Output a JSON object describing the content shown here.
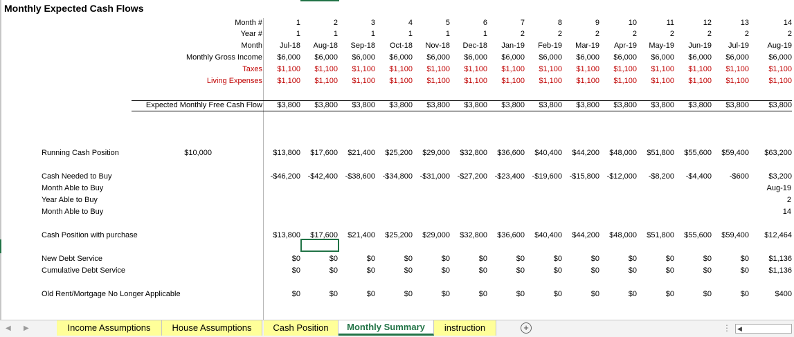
{
  "sheet_title": "Monthly Expected Cash Flows",
  "header_labels": {
    "month_num": "Month #",
    "year_num": "Year #",
    "month": "Month",
    "gross_income": "Monthly Gross Income",
    "taxes": "Taxes",
    "living": "Living Expenses",
    "free_cash": "Expected Monthly Free Cash Flow"
  },
  "month_nums": [
    "1",
    "2",
    "3",
    "4",
    "5",
    "6",
    "7",
    "8",
    "9",
    "10",
    "11",
    "12",
    "13",
    "14"
  ],
  "year_nums": [
    "1",
    "1",
    "1",
    "1",
    "1",
    "1",
    "2",
    "2",
    "2",
    "2",
    "2",
    "2",
    "2",
    "2"
  ],
  "months": [
    "Jul-18",
    "Aug-18",
    "Sep-18",
    "Oct-18",
    "Nov-18",
    "Dec-18",
    "Jan-19",
    "Feb-19",
    "Mar-19",
    "Apr-19",
    "May-19",
    "Jun-19",
    "Jul-19",
    "Aug-19"
  ],
  "gross_income": [
    "$6,000",
    "$6,000",
    "$6,000",
    "$6,000",
    "$6,000",
    "$6,000",
    "$6,000",
    "$6,000",
    "$6,000",
    "$6,000",
    "$6,000",
    "$6,000",
    "$6,000",
    "$6,000"
  ],
  "taxes": [
    "$1,100",
    "$1,100",
    "$1,100",
    "$1,100",
    "$1,100",
    "$1,100",
    "$1,100",
    "$1,100",
    "$1,100",
    "$1,100",
    "$1,100",
    "$1,100",
    "$1,100",
    "$1,100"
  ],
  "living": [
    "$1,100",
    "$1,100",
    "$1,100",
    "$1,100",
    "$1,100",
    "$1,100",
    "$1,100",
    "$1,100",
    "$1,100",
    "$1,100",
    "$1,100",
    "$1,100",
    "$1,100",
    "$1,100"
  ],
  "free_cash": [
    "$3,800",
    "$3,800",
    "$3,800",
    "$3,800",
    "$3,800",
    "$3,800",
    "$3,800",
    "$3,800",
    "$3,800",
    "$3,800",
    "$3,800",
    "$3,800",
    "$3,800",
    "$3,800"
  ],
  "left_labels": {
    "running": "Running Cash Position",
    "running_start": "$10,000",
    "cash_needed": "Cash Needed to Buy",
    "month_able": "Month Able to Buy",
    "year_able": "Year Able to Buy",
    "month_able2": "Month Able to Buy",
    "cash_with_purchase": "Cash Position with purchase",
    "new_debt": "New Debt Service",
    "cum_debt": "Cumulative Debt Service",
    "old_rent": "Old Rent/Mortgage No Longer Applicable"
  },
  "running": [
    "$13,800",
    "$17,600",
    "$21,400",
    "$25,200",
    "$29,000",
    "$32,800",
    "$36,600",
    "$40,400",
    "$44,200",
    "$48,000",
    "$51,800",
    "$55,600",
    "$59,400",
    "$63,200"
  ],
  "cash_needed": [
    "-$46,200",
    "-$42,400",
    "-$38,600",
    "-$34,800",
    "-$31,000",
    "-$27,200",
    "-$23,400",
    "-$19,600",
    "-$15,800",
    "-$12,000",
    "-$8,200",
    "-$4,400",
    "-$600",
    "$3,200"
  ],
  "buy_month": "Aug-19",
  "buy_year": "2",
  "buy_month_num": "14",
  "cash_with_purchase": [
    "$13,800",
    "$17,600",
    "$21,400",
    "$25,200",
    "$29,000",
    "$32,800",
    "$36,600",
    "$40,400",
    "$44,200",
    "$48,000",
    "$51,800",
    "$55,600",
    "$59,400",
    "$12,464"
  ],
  "new_debt": [
    "$0",
    "$0",
    "$0",
    "$0",
    "$0",
    "$0",
    "$0",
    "$0",
    "$0",
    "$0",
    "$0",
    "$0",
    "$0",
    "$1,136"
  ],
  "cum_debt": [
    "$0",
    "$0",
    "$0",
    "$0",
    "$0",
    "$0",
    "$0",
    "$0",
    "$0",
    "$0",
    "$0",
    "$0",
    "$0",
    "$1,136"
  ],
  "old_rent": [
    "$0",
    "$0",
    "$0",
    "$0",
    "$0",
    "$0",
    "$0",
    "$0",
    "$0",
    "$0",
    "$0",
    "$0",
    "$0",
    "$400"
  ],
  "tabs": [
    {
      "label": "Income Assumptions",
      "active": false
    },
    {
      "label": "House Assumptions",
      "active": false
    },
    {
      "label": "Cash Position",
      "active": false
    },
    {
      "label": "Monthly Summary",
      "active": true
    },
    {
      "label": "instruction",
      "active": false
    }
  ],
  "add_sheet_symbol": "+",
  "nav_prev": "◀",
  "nav_next": "▶",
  "scroll_arrow": "◀",
  "more_symbol": "⋮",
  "colors": {
    "red": "#c00000",
    "accent": "#217346",
    "tab_bg": "#ffff99"
  }
}
